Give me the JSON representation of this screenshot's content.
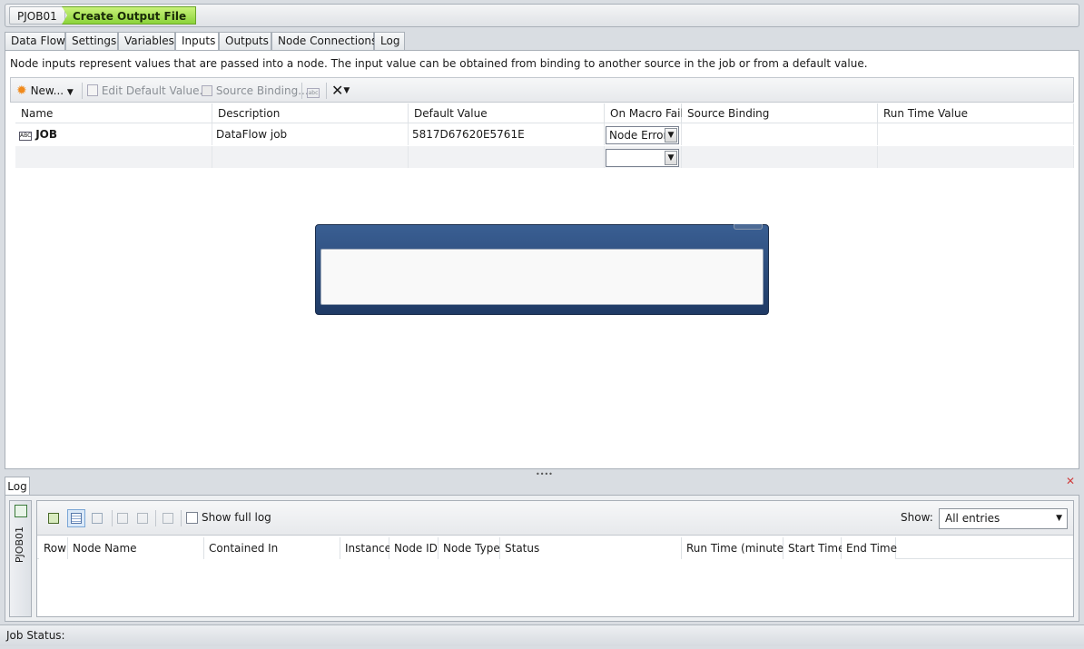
{
  "breadcrumb": {
    "job": "PJOB01",
    "node": "Create Output File"
  },
  "tabs": [
    "Data Flow",
    "Settings",
    "Variables",
    "Inputs",
    "Outputs",
    "Node Connections",
    "Log"
  ],
  "active_tab": "Inputs",
  "info_text": "Node inputs represent values that are passed into a node. The input value can be obtained from binding to another source in the job or from a default value.",
  "toolbar": {
    "new_label": "New...",
    "edit_default_label": "Edit Default Value...",
    "source_binding_label": "Source Binding..."
  },
  "grid": {
    "columns": [
      "Name",
      "Description",
      "Default Value",
      "On Macro Fail",
      "Source Binding",
      "Run Time Value"
    ],
    "rows": [
      {
        "name": "JOB",
        "description": "DataFlow job",
        "default_value": "5817D67620E5761E",
        "on_macro_fail": "Node Error",
        "source_binding": "",
        "run_time_value": ""
      },
      {
        "name": "",
        "description": "",
        "default_value": "",
        "on_macro_fail": "",
        "source_binding": "",
        "run_time_value": ""
      }
    ]
  },
  "log": {
    "tab_label": "Log",
    "side_label": "PJOB01",
    "show_full_log_label": "Show full log",
    "show_label": "Show:",
    "show_value": "All entries",
    "columns": [
      "Row",
      "Node Name",
      "Contained In",
      "Instance",
      "Node ID",
      "Node Type",
      "Status",
      "Run Time (minutes)",
      "Start Time",
      "End Time"
    ]
  },
  "status_bar": {
    "label": "Job Status:"
  },
  "colors": {
    "accent_green": "#8bd33a",
    "modal_blue": "#2c4a7a",
    "close_red": "#d04040"
  }
}
